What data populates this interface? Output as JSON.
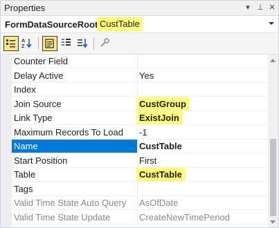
{
  "window": {
    "title": "Properties",
    "buttons": {
      "dropdown": "▾",
      "pin": "⊥",
      "close": "✕"
    }
  },
  "object": {
    "type": "FormDataSourceRoot",
    "name": "CustTable"
  },
  "toolbar": {
    "icons": [
      "categorized-icon",
      "alphabetical-icon",
      "properties-icon",
      "events-icon",
      "sort-icon",
      "wrench-icon"
    ],
    "pressed": [
      "categorized-icon",
      "properties-icon"
    ]
  },
  "colors": {
    "accent": "#0078d7",
    "highlight": "#fdfd79"
  },
  "properties": [
    {
      "name": "Counter Field",
      "value": ""
    },
    {
      "name": "Delay Active",
      "value": "Yes"
    },
    {
      "name": "Index",
      "value": ""
    },
    {
      "name": "Join Source",
      "value": "CustGroup",
      "bold": true,
      "highlight": true
    },
    {
      "name": "Link Type",
      "value": "ExistJoin",
      "bold": true,
      "highlight": true
    },
    {
      "name": "Maximum Records To Load",
      "value": "-1"
    },
    {
      "name": "Name",
      "value": "CustTable",
      "bold": true,
      "selected": true
    },
    {
      "name": "Start Position",
      "value": "First"
    },
    {
      "name": "Table",
      "value": "CustTable",
      "bold": true,
      "highlight": true
    },
    {
      "name": "Tags",
      "value": ""
    },
    {
      "name": "Valid Time State Auto Query",
      "value": "AsOfDate",
      "disabled": true
    },
    {
      "name": "Valid Time State Update",
      "value": "CreateNewTimePeriod",
      "disabled": true
    }
  ]
}
